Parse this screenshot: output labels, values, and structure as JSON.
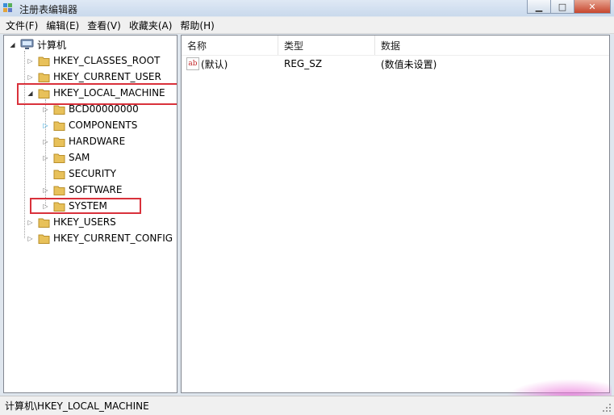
{
  "window": {
    "title": "注册表编辑器",
    "controls": [
      "minimize",
      "maximize",
      "close"
    ]
  },
  "menu": [
    "文件(F)",
    "编辑(E)",
    "查看(V)",
    "收藏夹(A)",
    "帮助(H)"
  ],
  "tree": {
    "root": "计算机",
    "hives": [
      "HKEY_CLASSES_ROOT",
      "HKEY_CURRENT_USER",
      "HKEY_LOCAL_MACHINE",
      "HKEY_USERS",
      "HKEY_CURRENT_CONFIG"
    ],
    "local_machine_children": [
      "BCD00000000",
      "COMPONENTS",
      "HARDWARE",
      "SAM",
      "SECURITY",
      "SOFTWARE",
      "SYSTEM"
    ]
  },
  "list": {
    "columns": [
      "名称",
      "类型",
      "数据"
    ],
    "rows": [
      {
        "name": "(默认)",
        "type": "REG_SZ",
        "data": "(数值未设置)",
        "icon": "ab-string-icon"
      }
    ]
  },
  "status": "计算机\\HKEY_LOCAL_MACHINE",
  "colors": {
    "highlight": "#d9313b",
    "folder": "#e8c15a",
    "titlebar": "#c9d9ec"
  }
}
